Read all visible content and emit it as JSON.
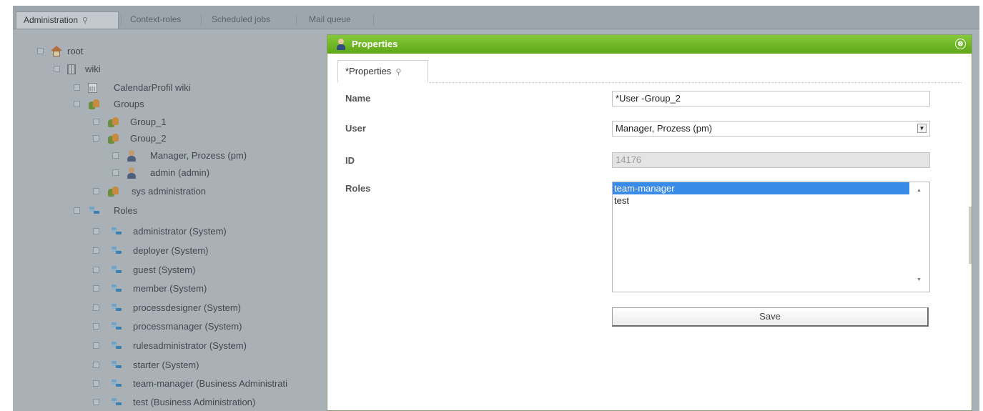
{
  "tabs": [
    {
      "label": "Administration",
      "active": true,
      "pinned": true
    },
    {
      "label": "Context-roles",
      "active": false
    },
    {
      "label": "Scheduled jobs",
      "active": false
    },
    {
      "label": "Mail queue",
      "active": false
    }
  ],
  "tree": {
    "root": {
      "label": "root",
      "icon": "home-icon"
    },
    "wiki": {
      "label": "wiki",
      "icon": "building-icon"
    },
    "calendar": {
      "label": "CalendarProfil wiki",
      "icon": "calendar-icon"
    },
    "groups": {
      "label": "Groups",
      "icon": "group-icon"
    },
    "group_1": {
      "label": "Group_1",
      "icon": "group-icon"
    },
    "group_2": {
      "label": "Group_2",
      "icon": "group-icon"
    },
    "member_pm": {
      "label": "Manager, Prozess (pm)",
      "icon": "user-icon"
    },
    "member_admin": {
      "label": "admin (admin)",
      "icon": "user-icon"
    },
    "sys_admin": {
      "label": "sys administration",
      "icon": "group-icon"
    },
    "roles": {
      "label": "Roles",
      "icon": "role-icon"
    },
    "role_items": [
      "administrator (System)",
      "deployer (System)",
      "guest (System)",
      "member (System)",
      "processdesigner (System)",
      "processmanager (System)",
      "rulesadministrator (System)",
      "starter (System)",
      "team-manager (Business Administrati",
      "test (Business Administration)"
    ]
  },
  "dialog": {
    "title": "Properties",
    "close_glyph": "⊗",
    "tab_label": "*Properties",
    "fields": {
      "name_label": "Name",
      "name_value": "*User -Group_2",
      "user_label": "User",
      "user_value": "Manager, Prozess (pm)",
      "id_label": "ID",
      "id_value": "14176",
      "roles_label": "Roles"
    },
    "roles_options": [
      {
        "label": "team-manager",
        "selected": true
      },
      {
        "label": "test",
        "selected": false
      }
    ],
    "save_label": "Save"
  },
  "colors": {
    "title_bar": "#6fb824",
    "selection": "#3a8be8",
    "overlay_bg": "#a9b1b7"
  }
}
